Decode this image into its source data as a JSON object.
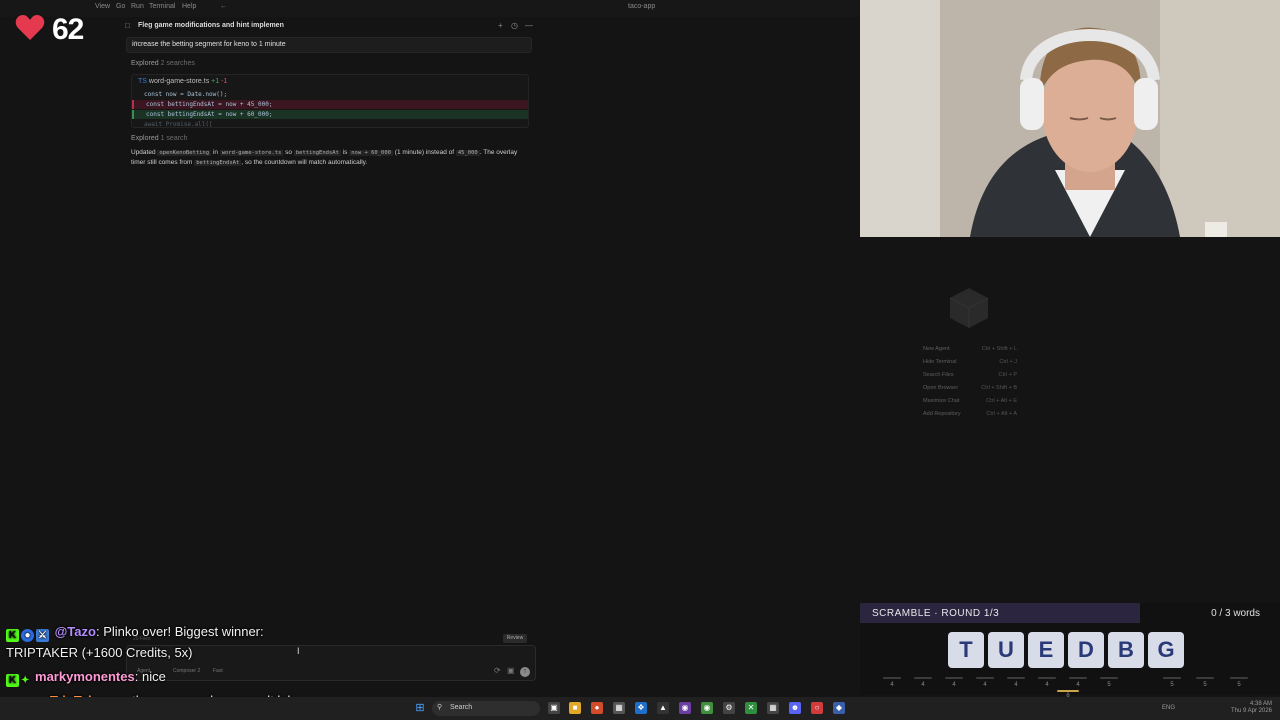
{
  "window": {
    "title": "taco-app",
    "menus": [
      "View",
      "Go",
      "Run",
      "Terminal",
      "Help"
    ]
  },
  "stream": {
    "hearts": "62"
  },
  "chat_panel": {
    "title": "Fleg game modifications and hint implemen",
    "user_message": "increase the betting segment for keno to 1 minute",
    "explored_1": {
      "label": "Explored",
      "count": "2 searches"
    },
    "diff": {
      "file": "word-game-store.ts",
      "added": "+1",
      "removed": "-1",
      "lines": [
        {
          "kind": "ctx",
          "text": "const now = Date.now();"
        },
        {
          "kind": "del",
          "text": "const bettingEndsAt = now + 45_000;"
        },
        {
          "kind": "add",
          "text": "const bettingEndsAt = now + 60_000;"
        },
        {
          "kind": "ctx",
          "text": "await Promise.all(["
        }
      ]
    },
    "explored_2": {
      "label": "Explored",
      "count": "1 search"
    },
    "summary": {
      "p1": "Updated",
      "c1": "openKenoBetting",
      "p2": "in",
      "c2": "word-game-store.ts",
      "p3": "so",
      "c3": "bettingEndsAt",
      "p4": "is",
      "c4": "now + 60_000",
      "p5": "(1 minute) instead of",
      "c5": "45_000",
      "p6": ". The overlay timer still comes from",
      "c6": "bettingEndsAt",
      "p7": ", so the countdown will match automatically."
    },
    "composer": {
      "review_label": "Review",
      "files_label": "20 Files",
      "agent_label": "Agent",
      "model_label": "Composer 2",
      "speed_label": "Fast"
    }
  },
  "stream_chat": [
    {
      "user": "@Tazo",
      "text": "Plinko over! Biggest winner:",
      "badges": [
        "K",
        "bot",
        "sword"
      ]
    },
    {
      "user": "",
      "text": "TRIPTAKER (+1600 Credits, 5x)",
      "badges": []
    },
    {
      "user": "markymonentes",
      "text": "nice",
      "badges": [
        "K",
        "spark"
      ]
    },
    {
      "user": "TripTaker",
      "text": "so there was no keno result lol",
      "badges": [
        "K",
        "pic",
        "spark"
      ]
    }
  ],
  "shortcuts": [
    {
      "label": "New Agent",
      "keys": "Ctrl + Shift + L"
    },
    {
      "label": "Hide Terminal",
      "keys": "Ctrl + J"
    },
    {
      "label": "Search Files",
      "keys": "Ctrl + P"
    },
    {
      "label": "Open Browser",
      "keys": "Ctrl + Shift + B"
    },
    {
      "label": "Maximize Chat",
      "keys": "Ctrl + Alt + E"
    },
    {
      "label": "Add Repository",
      "keys": "Ctrl + Alt + A"
    }
  ],
  "scramble": {
    "title": "SCRAMBLE · ROUND 1/3",
    "words": "0 / 3 words",
    "letters": [
      "T",
      "U",
      "E",
      "D",
      "B",
      "G"
    ],
    "slots": [
      "4",
      "4",
      "4",
      "4",
      "4",
      "4",
      "4",
      "5",
      "5",
      "5",
      "5"
    ],
    "selected_slot_label": "6"
  },
  "taskbar": {
    "search_label": "Search",
    "lang": "ENG",
    "time": "4:38 AM",
    "date": "Thu 9 Apr 2026"
  },
  "colors": {
    "kick_green": "#53fc18",
    "scramble_header": "#2c2540",
    "diff_del": "#3b1620",
    "diff_add": "#1a3324"
  }
}
